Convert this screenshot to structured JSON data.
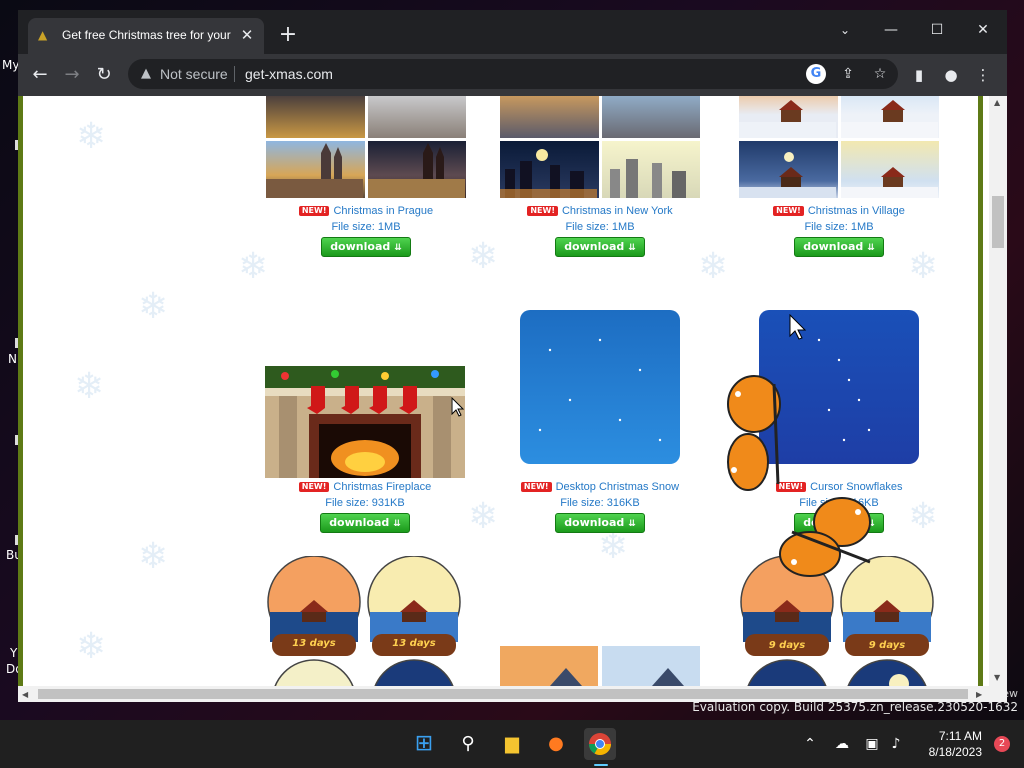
{
  "desktop": {
    "left_labels": [
      "My",
      "N",
      "Bu",
      "Y",
      "Do"
    ],
    "right_label": "ew",
    "watermark": "Evaluation copy. Build 25375.zn_release.230520-1632"
  },
  "browser": {
    "tab": {
      "title": "Get free Christmas tree for your d",
      "favicon": "christmas-tree-icon"
    },
    "window_controls": {
      "minimize": "—",
      "maximize": "☐",
      "close": "✕"
    },
    "address": {
      "security_label": "Not secure",
      "url": "get-xmas.com"
    }
  },
  "page": {
    "items": [
      {
        "title": "Christmas in Prague",
        "size": "File size: 1MB",
        "button": "download",
        "new": "NEW!"
      },
      {
        "title": "Christmas in New York",
        "size": "File size: 1MB",
        "button": "download",
        "new": "NEW!"
      },
      {
        "title": "Christmas in Village",
        "size": "File size: 1MB",
        "button": "download",
        "new": "NEW!"
      },
      {
        "title": "Christmas Fireplace",
        "size": "File size: 931KB",
        "button": "download",
        "new": "NEW!"
      },
      {
        "title": "Desktop Christmas Snow",
        "size": "File size: 316KB",
        "button": "download",
        "new": "NEW!"
      },
      {
        "title": "Cursor Snowflakes",
        "size": "File size: 316KB",
        "button": "download",
        "new": "NEW!"
      }
    ],
    "globe_days": [
      "13 days",
      "13 days",
      "9 days",
      "9 days"
    ]
  },
  "taskbar": {
    "time": "7:11 AM",
    "date": "8/18/2023",
    "notification_count": "2"
  }
}
